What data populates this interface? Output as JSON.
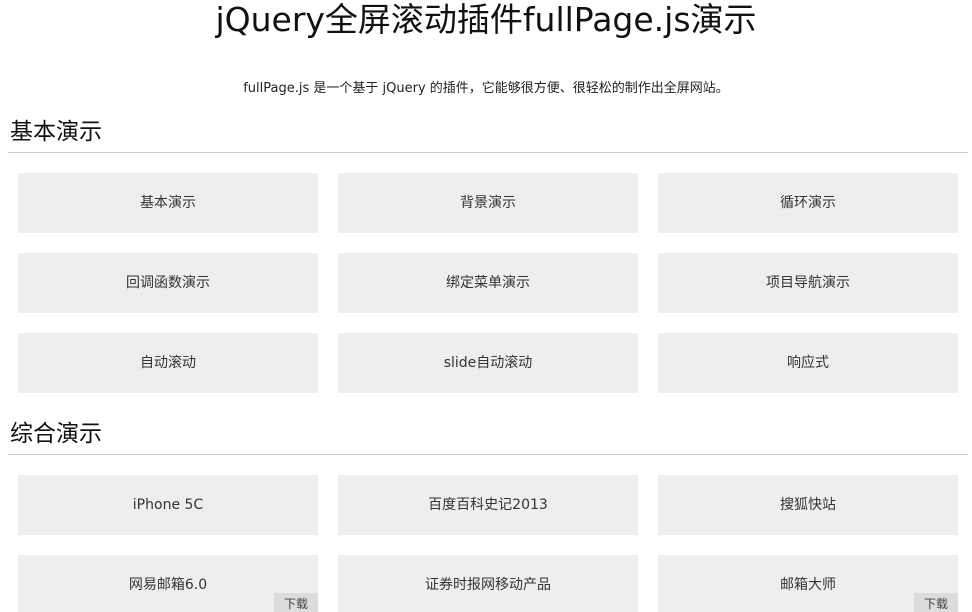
{
  "page_title": "jQuery全屏滚动插件fullPage.js演示",
  "intro": "fullPage.js 是一个基于 jQuery 的插件，它能够很方便、很轻松的制作出全屏网站。",
  "sections": [
    {
      "heading": "基本演示",
      "tiles": [
        {
          "label": "基本演示"
        },
        {
          "label": "背景演示"
        },
        {
          "label": "循环演示"
        },
        {
          "label": "回调函数演示"
        },
        {
          "label": "绑定菜单演示"
        },
        {
          "label": "项目导航演示"
        },
        {
          "label": "自动滚动"
        },
        {
          "label": "slide自动滚动"
        },
        {
          "label": "响应式"
        }
      ]
    },
    {
      "heading": "综合演示",
      "tiles": [
        {
          "label": "iPhone 5C"
        },
        {
          "label": "百度百科史记2013"
        },
        {
          "label": "搜狐快站"
        },
        {
          "label": "网易邮箱6.0",
          "download": "下载"
        },
        {
          "label": "证券时报网移动产品"
        },
        {
          "label": "邮箱大师",
          "download": "下载"
        }
      ]
    }
  ]
}
